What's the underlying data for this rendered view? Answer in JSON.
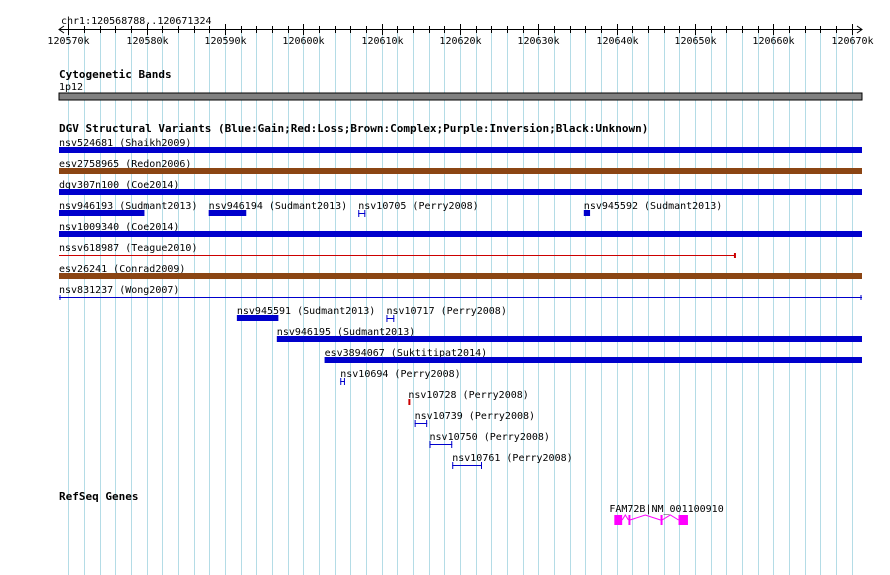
{
  "region": {
    "label": "chr1:120568788..120671324",
    "start": 120568788,
    "end": 120671324
  },
  "ruler": {
    "ticks": [
      {
        "pos": 120570000,
        "label": "120570k"
      },
      {
        "pos": 120580000,
        "label": "120580k"
      },
      {
        "pos": 120590000,
        "label": "120590k"
      },
      {
        "pos": 120600000,
        "label": "120600k"
      },
      {
        "pos": 120610000,
        "label": "120610k"
      },
      {
        "pos": 120620000,
        "label": "120620k"
      },
      {
        "pos": 120630000,
        "label": "120630k"
      },
      {
        "pos": 120640000,
        "label": "120640k"
      },
      {
        "pos": 120650000,
        "label": "120650k"
      },
      {
        "pos": 120660000,
        "label": "120660k"
      },
      {
        "pos": 120670000,
        "label": "120670k"
      }
    ],
    "grid_spacing_bp": 2000
  },
  "cytoband": {
    "title": "Cytogenetic Bands",
    "band": "1p12",
    "color": "#808080"
  },
  "dgv": {
    "title": "DGV Structural Variants (Blue:Gain;Red:Loss;Brown:Complex;Purple:Inversion;Black:Unknown)",
    "colors": {
      "gain": "#0000cc",
      "loss": "#cc0000",
      "complex": "#8b4513",
      "inversion": "#800080",
      "unknown": "#000000"
    },
    "features": [
      {
        "id": "nsv524681 (Shaikh2009)",
        "start": 120568788,
        "end": 120671324,
        "type": "gain",
        "style": "bar",
        "row": 0
      },
      {
        "id": "esv2758965 (Redon2006)",
        "start": 120568788,
        "end": 120671324,
        "type": "complex",
        "style": "bar",
        "row": 1
      },
      {
        "id": "dgv307n100 (Coe2014)",
        "start": 120568788,
        "end": 120671324,
        "type": "gain",
        "style": "bar",
        "row": 2
      },
      {
        "id": "nsv946193 (Sudmant2013)",
        "start": 120568788,
        "end": 120579700,
        "type": "gain",
        "style": "bar",
        "row": 3
      },
      {
        "id": "nsv946194 (Sudmant2013)",
        "start": 120587900,
        "end": 120592700,
        "type": "gain",
        "style": "bar",
        "row": 3
      },
      {
        "id": "nsv10705 (Perry2008)",
        "start": 120607000,
        "end": 120607900,
        "type": "gain",
        "style": "bracket",
        "row": 3
      },
      {
        "id": "nsv945592 (Sudmant2013)",
        "start": 120635800,
        "end": 120636600,
        "type": "gain",
        "style": "bar",
        "row": 3
      },
      {
        "id": "nsv1009340 (Coe2014)",
        "start": 120568788,
        "end": 120671324,
        "type": "gain",
        "style": "bar",
        "row": 4
      },
      {
        "id": "nssv618987 (Teague2010)",
        "start": 120568788,
        "end": 120655100,
        "type": "loss",
        "style": "line",
        "row": 5
      },
      {
        "id": "esv26241 (Conrad2009)",
        "start": 120568788,
        "end": 120671324,
        "type": "complex",
        "style": "bar",
        "row": 6
      },
      {
        "id": "nsv831237 (Wong2007)",
        "start": 120568788,
        "end": 120671324,
        "type": "gain",
        "style": "line",
        "row": 7
      },
      {
        "id": "nsv945591 (Sudmant2013)",
        "start": 120591500,
        "end": 120596800,
        "type": "gain",
        "style": "bar",
        "row": 8
      },
      {
        "id": "nsv10717 (Perry2008)",
        "start": 120610600,
        "end": 120611600,
        "type": "gain",
        "style": "bracket",
        "row": 8
      },
      {
        "id": "nsv946195 (Sudmant2013)",
        "start": 120596600,
        "end": 120671324,
        "type": "gain",
        "style": "bar",
        "row": 9
      },
      {
        "id": "esv3894067 (Suktitipat2014)",
        "start": 120602700,
        "end": 120671324,
        "type": "gain",
        "style": "bar",
        "row": 10
      },
      {
        "id": "nsv10694 (Perry2008)",
        "start": 120604700,
        "end": 120605300,
        "type": "gain",
        "style": "bracket",
        "row": 11
      },
      {
        "id": "nsv10728 (Perry2008)",
        "start": 120613400,
        "end": 120613600,
        "type": "loss",
        "style": "bar",
        "row": 12
      },
      {
        "id": "nsv10739 (Perry2008)",
        "start": 120614200,
        "end": 120615800,
        "type": "gain",
        "style": "bracket",
        "row": 13
      },
      {
        "id": "nsv10750 (Perry2008)",
        "start": 120616100,
        "end": 120619000,
        "type": "gain",
        "style": "bracket",
        "row": 14
      },
      {
        "id": "nsv10761 (Perry2008)",
        "start": 120619000,
        "end": 120622800,
        "type": "gain",
        "style": "bracket",
        "row": 15
      }
    ]
  },
  "refseq": {
    "title": "RefSeq Genes",
    "color": "#ff00ff",
    "genes": [
      {
        "label": "FAM72B|NM_001100910",
        "start": 120639700,
        "end": 120649100,
        "exons": [
          {
            "start": 120639700,
            "end": 120640700
          },
          {
            "start": 120641500,
            "end": 120641700
          },
          {
            "start": 120645600,
            "end": 120645800
          },
          {
            "start": 120647900,
            "end": 120649100
          }
        ]
      }
    ]
  }
}
